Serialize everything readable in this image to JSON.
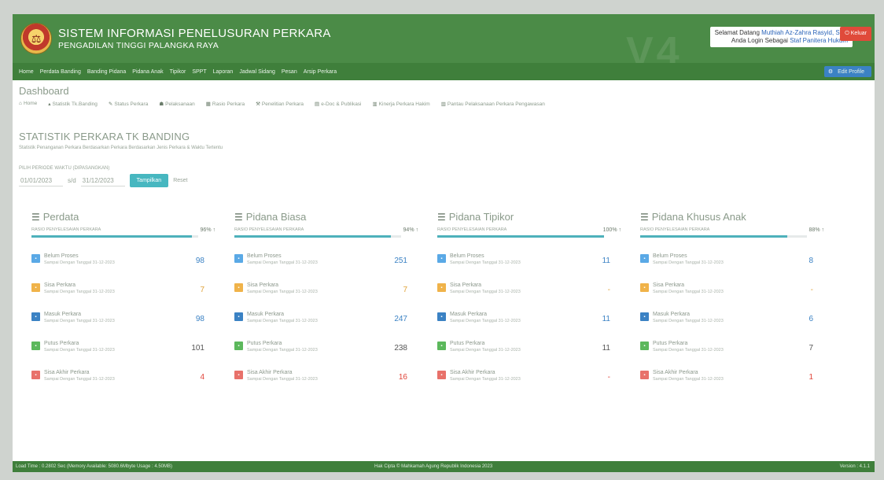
{
  "header": {
    "title": "SISTEM INFORMASI PENELUSURAN PERKARA",
    "subtitle": "PENGADILAN TINGGI PALANGKA RAYA",
    "watermark": "V4",
    "user": {
      "greeting": "Selamat Datang",
      "name": "Muthiah Az-Zahra Rasyid, S.H.",
      "login_as": "Anda Login Sebagai",
      "role": "Staf Panitera Hukum"
    },
    "logout_label": "Keluar",
    "edit_profile_label": "Edit Profile"
  },
  "nav": [
    "Home",
    "Perdata Banding",
    "Banding Pidana",
    "Pidana Anak",
    "Tipikor",
    "SPPT",
    "Laporan",
    "Jadwal Sidang",
    "Pesan",
    "Arsip Perkara"
  ],
  "dashboard": {
    "title": "Dashboard",
    "breadcrumbs": [
      "Home",
      "Statistik Tk.Banding",
      "Status Perkara",
      "Pelaksanaan",
      "Rasio Perkara",
      "Penelitian Perkara",
      "e-Doc & Publikasi",
      "Kinerja Perkara Hakim",
      "Pantau Pelaksanaan Perkara Pengawasan"
    ]
  },
  "section": {
    "title": "STATISTIK PERKARA TK BANDING",
    "subtitle": "Statistik Penanganan Perkara Berdasarkan Perkara Berdasarkan Jenis Perkara & Waktu Tertentu",
    "period_label": "PILIH PERIODE WAKTU (DIPASANGKAN)",
    "date_from": "01/01/2023",
    "sd": "s/d",
    "date_to": "31/12/2023",
    "show_label": "Tampilkan",
    "reset_label": "Reset"
  },
  "columns": [
    {
      "title": "Perdata",
      "rasio_label": "RASIO PENYELESAIAN PERKARA",
      "pct": "96%",
      "pct_value": 0.96,
      "items": [
        {
          "label": "Belum Proses",
          "sub": "Sampai Dengan Tanggal 31-12-2023",
          "value": "98"
        },
        {
          "label": "Sisa Perkara",
          "sub": "Sampai Dengan Tanggal 31-12-2023",
          "value": "7"
        },
        {
          "label": "Masuk Perkara",
          "sub": "Sampai Dengan Tanggal 31-12-2023",
          "value": "98"
        },
        {
          "label": "Putus Perkara",
          "sub": "Sampai Dengan Tanggal 31-12-2023",
          "value": "101"
        },
        {
          "label": "Sisa Akhir Perkara",
          "sub": "Sampai Dengan Tanggal 31-12-2023",
          "value": "4"
        }
      ]
    },
    {
      "title": "Pidana Biasa",
      "rasio_label": "RASIO PENYELESAIAN PERKARA",
      "pct": "94%",
      "pct_value": 0.94,
      "items": [
        {
          "label": "Belum Proses",
          "sub": "Sampai Dengan Tanggal 31-12-2023",
          "value": "251"
        },
        {
          "label": "Sisa Perkara",
          "sub": "Sampai Dengan Tanggal 31-12-2023",
          "value": "7"
        },
        {
          "label": "Masuk Perkara",
          "sub": "Sampai Dengan Tanggal 31-12-2023",
          "value": "247"
        },
        {
          "label": "Putus Perkara",
          "sub": "Sampai Dengan Tanggal 31-12-2023",
          "value": "238"
        },
        {
          "label": "Sisa Akhir Perkara",
          "sub": "Sampai Dengan Tanggal 31-12-2023",
          "value": "16"
        }
      ]
    },
    {
      "title": "Pidana Tipikor",
      "rasio_label": "RASIO PENYELESAIAN PERKARA",
      "pct": "100%",
      "pct_value": 1.0,
      "items": [
        {
          "label": "Belum Proses",
          "sub": "Sampai Dengan Tanggal 31-12-2023",
          "value": "11"
        },
        {
          "label": "Sisa Perkara",
          "sub": "Sampai Dengan Tanggal 31-12-2023",
          "value": "-"
        },
        {
          "label": "Masuk Perkara",
          "sub": "Sampai Dengan Tanggal 31-12-2023",
          "value": "11"
        },
        {
          "label": "Putus Perkara",
          "sub": "Sampai Dengan Tanggal 31-12-2023",
          "value": "11"
        },
        {
          "label": "Sisa Akhir Perkara",
          "sub": "Sampai Dengan Tanggal 31-12-2023",
          "value": "-"
        }
      ]
    },
    {
      "title": "Pidana Khusus Anak",
      "rasio_label": "RASIO PENYELESAIAN PERKARA",
      "pct": "88%",
      "pct_value": 0.88,
      "items": [
        {
          "label": "Belum Proses",
          "sub": "Sampai Dengan Tanggal 31-12-2023",
          "value": "8"
        },
        {
          "label": "Sisa Perkara",
          "sub": "Sampai Dengan Tanggal 31-12-2023",
          "value": "-"
        },
        {
          "label": "Masuk Perkara",
          "sub": "Sampai Dengan Tanggal 31-12-2023",
          "value": "6"
        },
        {
          "label": "Putus Perkara",
          "sub": "Sampai Dengan Tanggal 31-12-2023",
          "value": "7"
        },
        {
          "label": "Sisa Akhir Perkara",
          "sub": "Sampai Dengan Tanggal 31-12-2023",
          "value": "1"
        }
      ]
    }
  ],
  "item_styles": [
    {
      "color": "#5aa9e6",
      "value_color": "#3b82c4"
    },
    {
      "color": "#f0b34a",
      "value_color": "#e0a33a"
    },
    {
      "color": "#3b82c4",
      "value_color": "#3b82c4"
    },
    {
      "color": "#5cb85c",
      "value_color": "#555555"
    },
    {
      "color": "#e8716a",
      "value_color": "#e0453a"
    }
  ],
  "footer": {
    "load_time": "Load Time : 0.2802 Sec (Memory Available: 5080.6Mbyte Usage : 4.50MB)",
    "copyright": "Hak Cipta © Mahkamah Agung Republik Indonesia 2023",
    "version": "Version : 4.1.1"
  },
  "colors": {
    "header": "#4b8b47",
    "nav": "#3f7f3b",
    "accent": "#4eb1bb"
  }
}
